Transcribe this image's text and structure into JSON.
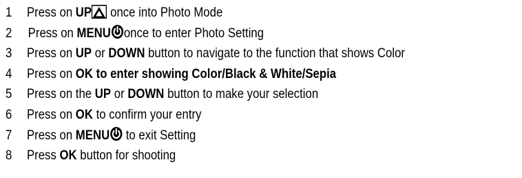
{
  "steps": [
    {
      "number": "1",
      "parts": {
        "t1": "Press on ",
        "b1": "UP",
        "icon": "up-triangle-icon",
        "t2": " once into Photo Mode"
      }
    },
    {
      "number": "2",
      "parts": {
        "t1": "Press on ",
        "b1": "MENU",
        "icon": "power-icon",
        "t2": "once to enter Photo Setting"
      }
    },
    {
      "number": "3",
      "parts": {
        "t1": "Press on ",
        "b1": "UP",
        "t2": " or ",
        "b2": "DOWN",
        "t3": " button to navigate to the function that shows Color"
      }
    },
    {
      "number": "4",
      "parts": {
        "t1": "Press on ",
        "b1": "OK to enter showing Color/Black & White/Sepia"
      }
    },
    {
      "number": "5",
      "parts": {
        "t1": "Press on the ",
        "b1": "UP",
        "t2": " or ",
        "b2": "DOWN",
        "t3": " button to make your selection"
      }
    },
    {
      "number": "6",
      "parts": {
        "t1": "Press on ",
        "b1": "OK",
        "t2": " to confirm your entry"
      }
    },
    {
      "number": "7",
      "parts": {
        "t1": "Press on ",
        "b1": "MENU",
        "icon": "power-icon",
        "t2": " to exit Setting"
      }
    },
    {
      "number": "8",
      "parts": {
        "t1": "Press ",
        "b1": "OK",
        "t2": " button for shooting"
      }
    }
  ],
  "colors": {
    "text": "#000000",
    "background": "#ffffff"
  }
}
